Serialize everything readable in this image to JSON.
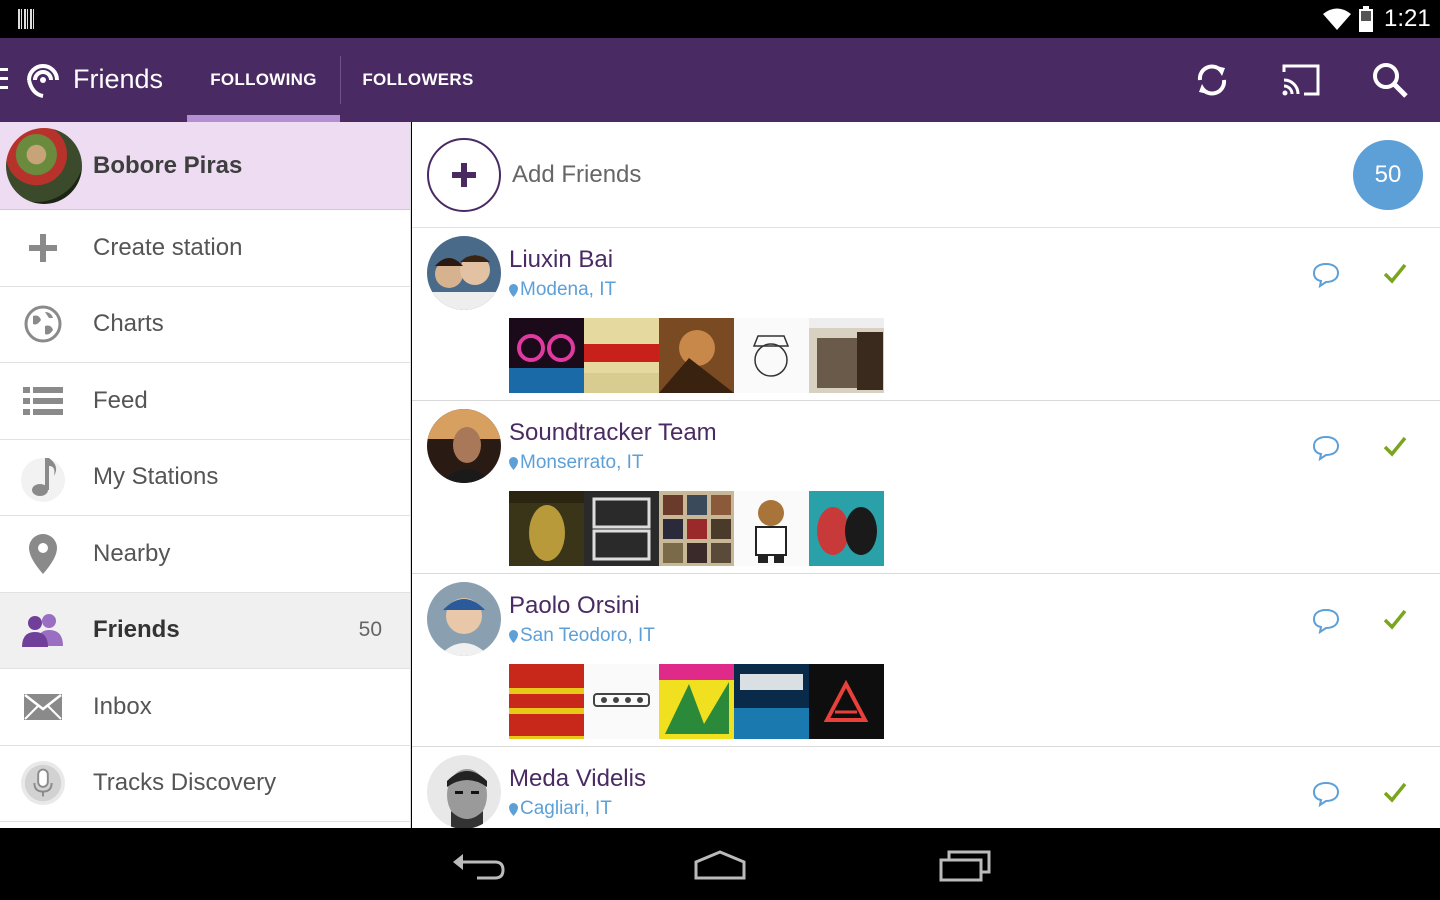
{
  "status_bar": {
    "time": "1:21"
  },
  "app_bar": {
    "title": "Friends",
    "tabs": [
      {
        "label": "FOLLOWING",
        "selected": true
      },
      {
        "label": "FOLLOWERS",
        "selected": false
      }
    ],
    "actions": [
      "refresh-icon",
      "cast-icon",
      "search-icon"
    ],
    "color": "#4a2a62"
  },
  "drawer": {
    "profile_name": "Bobore Piras",
    "items": [
      {
        "label": "Create station",
        "icon": "plus-icon"
      },
      {
        "label": "Charts",
        "icon": "globe-icon"
      },
      {
        "label": "Feed",
        "icon": "list-icon"
      },
      {
        "label": "My Stations",
        "icon": "music-note-icon"
      },
      {
        "label": "Nearby",
        "icon": "location-pin-icon"
      },
      {
        "label": "Friends",
        "icon": "friends-icon",
        "count": "50",
        "active": true
      },
      {
        "label": "Inbox",
        "icon": "envelope-icon"
      },
      {
        "label": "Tracks Discovery",
        "icon": "microphone-icon"
      }
    ]
  },
  "content": {
    "add_friends_label": "Add Friends",
    "friends_count": "50",
    "friends": [
      {
        "name": "Liuxin Bai",
        "location": "Modena, IT"
      },
      {
        "name": "Soundtracker Team",
        "location": "Monserrato, IT"
      },
      {
        "name": "Paolo Orsini",
        "location": "San Teodoro, IT"
      },
      {
        "name": "Meda Videlis",
        "location": "Cagliari, IT"
      }
    ]
  },
  "colors": {
    "accent": "#4a2a62",
    "tab_indicator": "#b48fd2",
    "badge": "#5da0d8",
    "check": "#7aa51e"
  }
}
